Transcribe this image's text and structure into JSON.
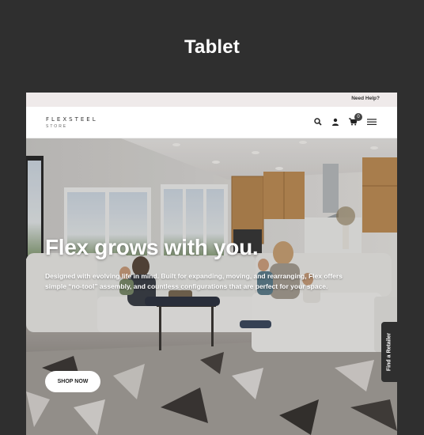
{
  "frame": {
    "title": "Tablet"
  },
  "utility": {
    "help_label": "Need Help?"
  },
  "header": {
    "logo_main": "FLEXSTEEL",
    "logo_sub": "STORE",
    "cart_count": "0",
    "icons": [
      "search-icon",
      "account-icon",
      "cart-icon",
      "menu-icon"
    ]
  },
  "hero": {
    "heading": "Flex grows with you.",
    "body_line1": "Designed with evolving life in mind. Built for expanding, moving, and rearranging, Flex offers",
    "body_line2": "simple “no-tool” assembly, and countless configurations that are perfect for your space.",
    "cta_label": "SHOP NOW"
  },
  "side_tab": {
    "label": "Find a Retailer"
  },
  "colors": {
    "frame_bg": "#2f2f2f",
    "utility_bar": "#efeaea",
    "tab_bg": "#2f2f2f"
  }
}
